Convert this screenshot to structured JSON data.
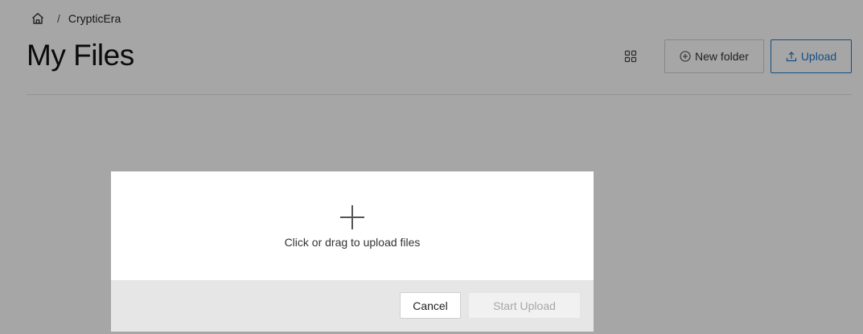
{
  "breadcrumb": {
    "home_icon": "home-icon",
    "separator": "/",
    "current": "CrypticEra"
  },
  "page": {
    "title": "My Files"
  },
  "toolbar": {
    "view_icon": "grid-view-icon",
    "new_folder_icon": "plus-circle-icon",
    "new_folder_label": "New folder",
    "upload_icon": "upload-icon",
    "upload_label": "Upload"
  },
  "upload_modal": {
    "dropzone_icon": "plus-icon",
    "dropzone_hint": "Click or drag to upload files",
    "cancel_label": "Cancel",
    "start_label": "Start Upload",
    "start_disabled": true
  },
  "colors": {
    "accent": "#1f78c8",
    "overlay": "rgba(0,0,0,0.35)",
    "footer_bg": "#e6e6e6"
  }
}
